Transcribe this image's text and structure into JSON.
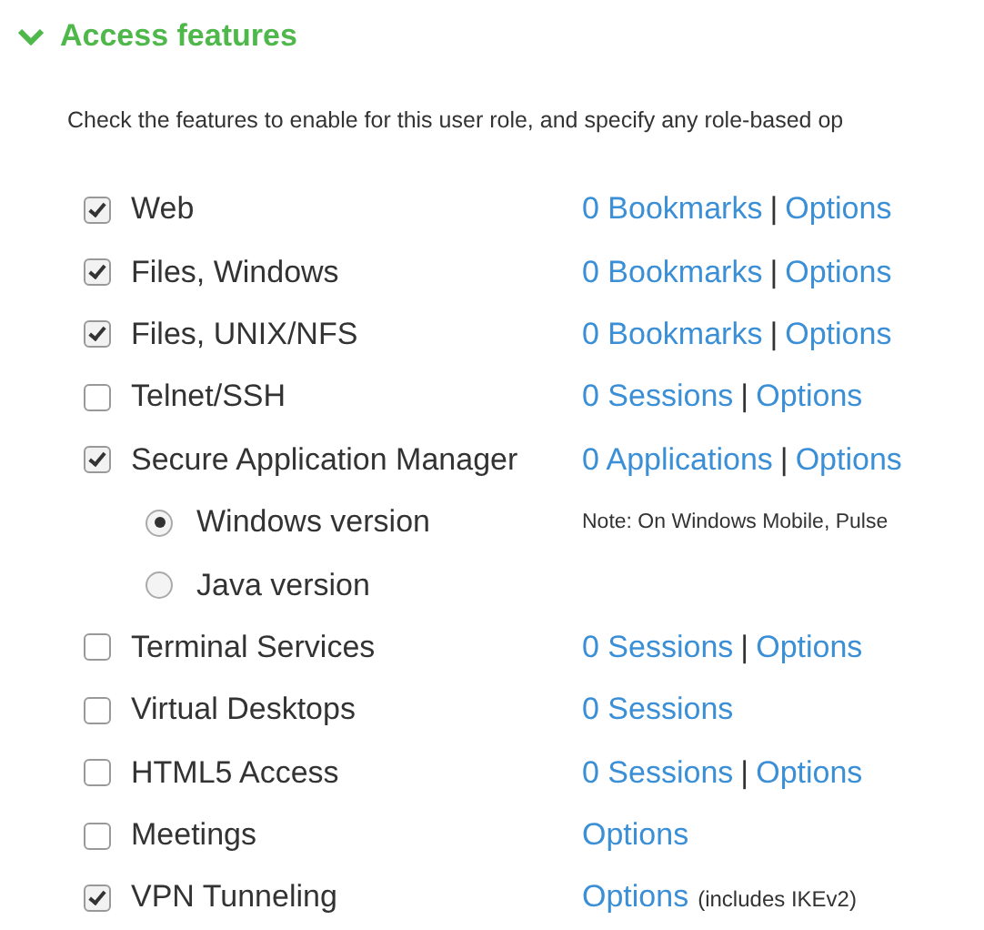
{
  "section": {
    "title": "Access features",
    "expanded": true,
    "intro": "Check the features to enable for this user role, and specify any role-based op"
  },
  "features": [
    {
      "name": "Web",
      "kind": "checkbox",
      "checked": true,
      "items": [
        {
          "kind": "link",
          "text": "0 Bookmarks"
        },
        {
          "kind": "separator",
          "text": "|"
        },
        {
          "kind": "link",
          "text": "Options"
        }
      ]
    },
    {
      "name": "Files, Windows",
      "kind": "checkbox",
      "checked": true,
      "items": [
        {
          "kind": "link",
          "text": "0 Bookmarks"
        },
        {
          "kind": "separator",
          "text": "|"
        },
        {
          "kind": "link",
          "text": "Options"
        }
      ]
    },
    {
      "name": "Files, UNIX/NFS",
      "kind": "checkbox",
      "checked": true,
      "items": [
        {
          "kind": "link",
          "text": "0 Bookmarks"
        },
        {
          "kind": "separator",
          "text": "|"
        },
        {
          "kind": "link",
          "text": "Options"
        }
      ]
    },
    {
      "name": "Telnet/SSH",
      "kind": "checkbox",
      "checked": false,
      "items": [
        {
          "kind": "link",
          "text": "0 Sessions"
        },
        {
          "kind": "separator",
          "text": "|"
        },
        {
          "kind": "link",
          "text": "Options"
        }
      ]
    },
    {
      "name": "Secure Application Manager",
      "kind": "checkbox",
      "checked": true,
      "items": [
        {
          "kind": "link",
          "text": "0 Applications"
        },
        {
          "kind": "separator",
          "text": "|"
        },
        {
          "kind": "link",
          "text": "Options"
        }
      ]
    },
    {
      "name": "Windows version",
      "kind": "radio",
      "selected": true,
      "items": [
        {
          "kind": "note",
          "text": "Note: On Windows Mobile, Pulse"
        }
      ]
    },
    {
      "name": "Java version",
      "kind": "radio",
      "selected": false
    },
    {
      "name": "Terminal Services",
      "kind": "checkbox",
      "checked": false,
      "items": [
        {
          "kind": "link",
          "text": "0 Sessions"
        },
        {
          "kind": "separator",
          "text": "|"
        },
        {
          "kind": "link",
          "text": "Options"
        }
      ]
    },
    {
      "name": "Virtual Desktops",
      "kind": "checkbox",
      "checked": false,
      "items": [
        {
          "kind": "link",
          "text": "0 Sessions"
        }
      ]
    },
    {
      "name": "HTML5 Access",
      "kind": "checkbox",
      "checked": false,
      "items": [
        {
          "kind": "link",
          "text": "0 Sessions"
        },
        {
          "kind": "separator",
          "text": "|"
        },
        {
          "kind": "link",
          "text": "Options"
        }
      ]
    },
    {
      "name": "Meetings",
      "kind": "checkbox",
      "checked": false,
      "items": [
        {
          "kind": "link",
          "text": "Options"
        }
      ]
    },
    {
      "name": "VPN Tunneling",
      "kind": "checkbox",
      "checked": true,
      "items": [
        {
          "kind": "link",
          "text": "Options"
        },
        {
          "kind": "aside",
          "text": "(includes IKEv2)"
        }
      ]
    }
  ]
}
